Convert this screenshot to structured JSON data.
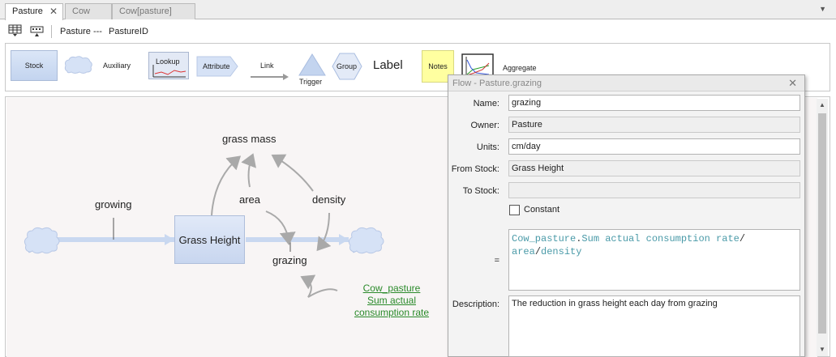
{
  "tabs": [
    {
      "label": "Pasture",
      "active": true,
      "closable": true
    },
    {
      "label": "Cow",
      "active": false
    },
    {
      "label": "Cow[pasture]",
      "active": false
    }
  ],
  "toolbar": {
    "title_text": "Pasture ---",
    "id_text": "PastureID"
  },
  "palette": {
    "stock": "Stock",
    "auxiliary": "Auxiliary",
    "lookup": "Lookup",
    "attribute": "Attribute",
    "link": "Link",
    "trigger": "Trigger",
    "group": "Group",
    "label": "Label",
    "notes": "Notes",
    "aggregate": "Aggregate"
  },
  "diagram": {
    "grass_mass": "grass mass",
    "growing": "growing",
    "area": "area",
    "density": "density",
    "stock_name": "Grass Height",
    "grazing": "grazing",
    "ghost_line1": "Cow_pasture",
    "ghost_line2": "Sum actual",
    "ghost_line3": "consumption rate"
  },
  "dialog": {
    "title": "Flow - Pasture.grazing",
    "labels": {
      "name": "Name:",
      "owner": "Owner:",
      "units": "Units:",
      "from_stock": "From Stock:",
      "to_stock": "To Stock:",
      "equals": "=",
      "description": "Description:"
    },
    "name_value": "grazing",
    "owner_value": "Pasture",
    "units_value": "cm/day",
    "from_stock_value": "Grass Height",
    "to_stock_value": "",
    "constant_label": "Constant",
    "constant_checked": false,
    "equation": {
      "part1": "Cow_pasture",
      "op1": ".",
      "part2": "Sum actual consumption rate",
      "op2": "/",
      "part3": "area",
      "op3": "/",
      "part4": "density"
    },
    "description_value": "The reduction in grass height each day from grazing"
  },
  "colors": {
    "stock_fill": "#c8d6ef",
    "flow_pipe": "#c9d8f0",
    "link_arrow": "#a9a9a9",
    "ghost_text": "#2a8a2a",
    "equation_text": "#4a9aa8",
    "notes_fill": "#ffffa0"
  }
}
